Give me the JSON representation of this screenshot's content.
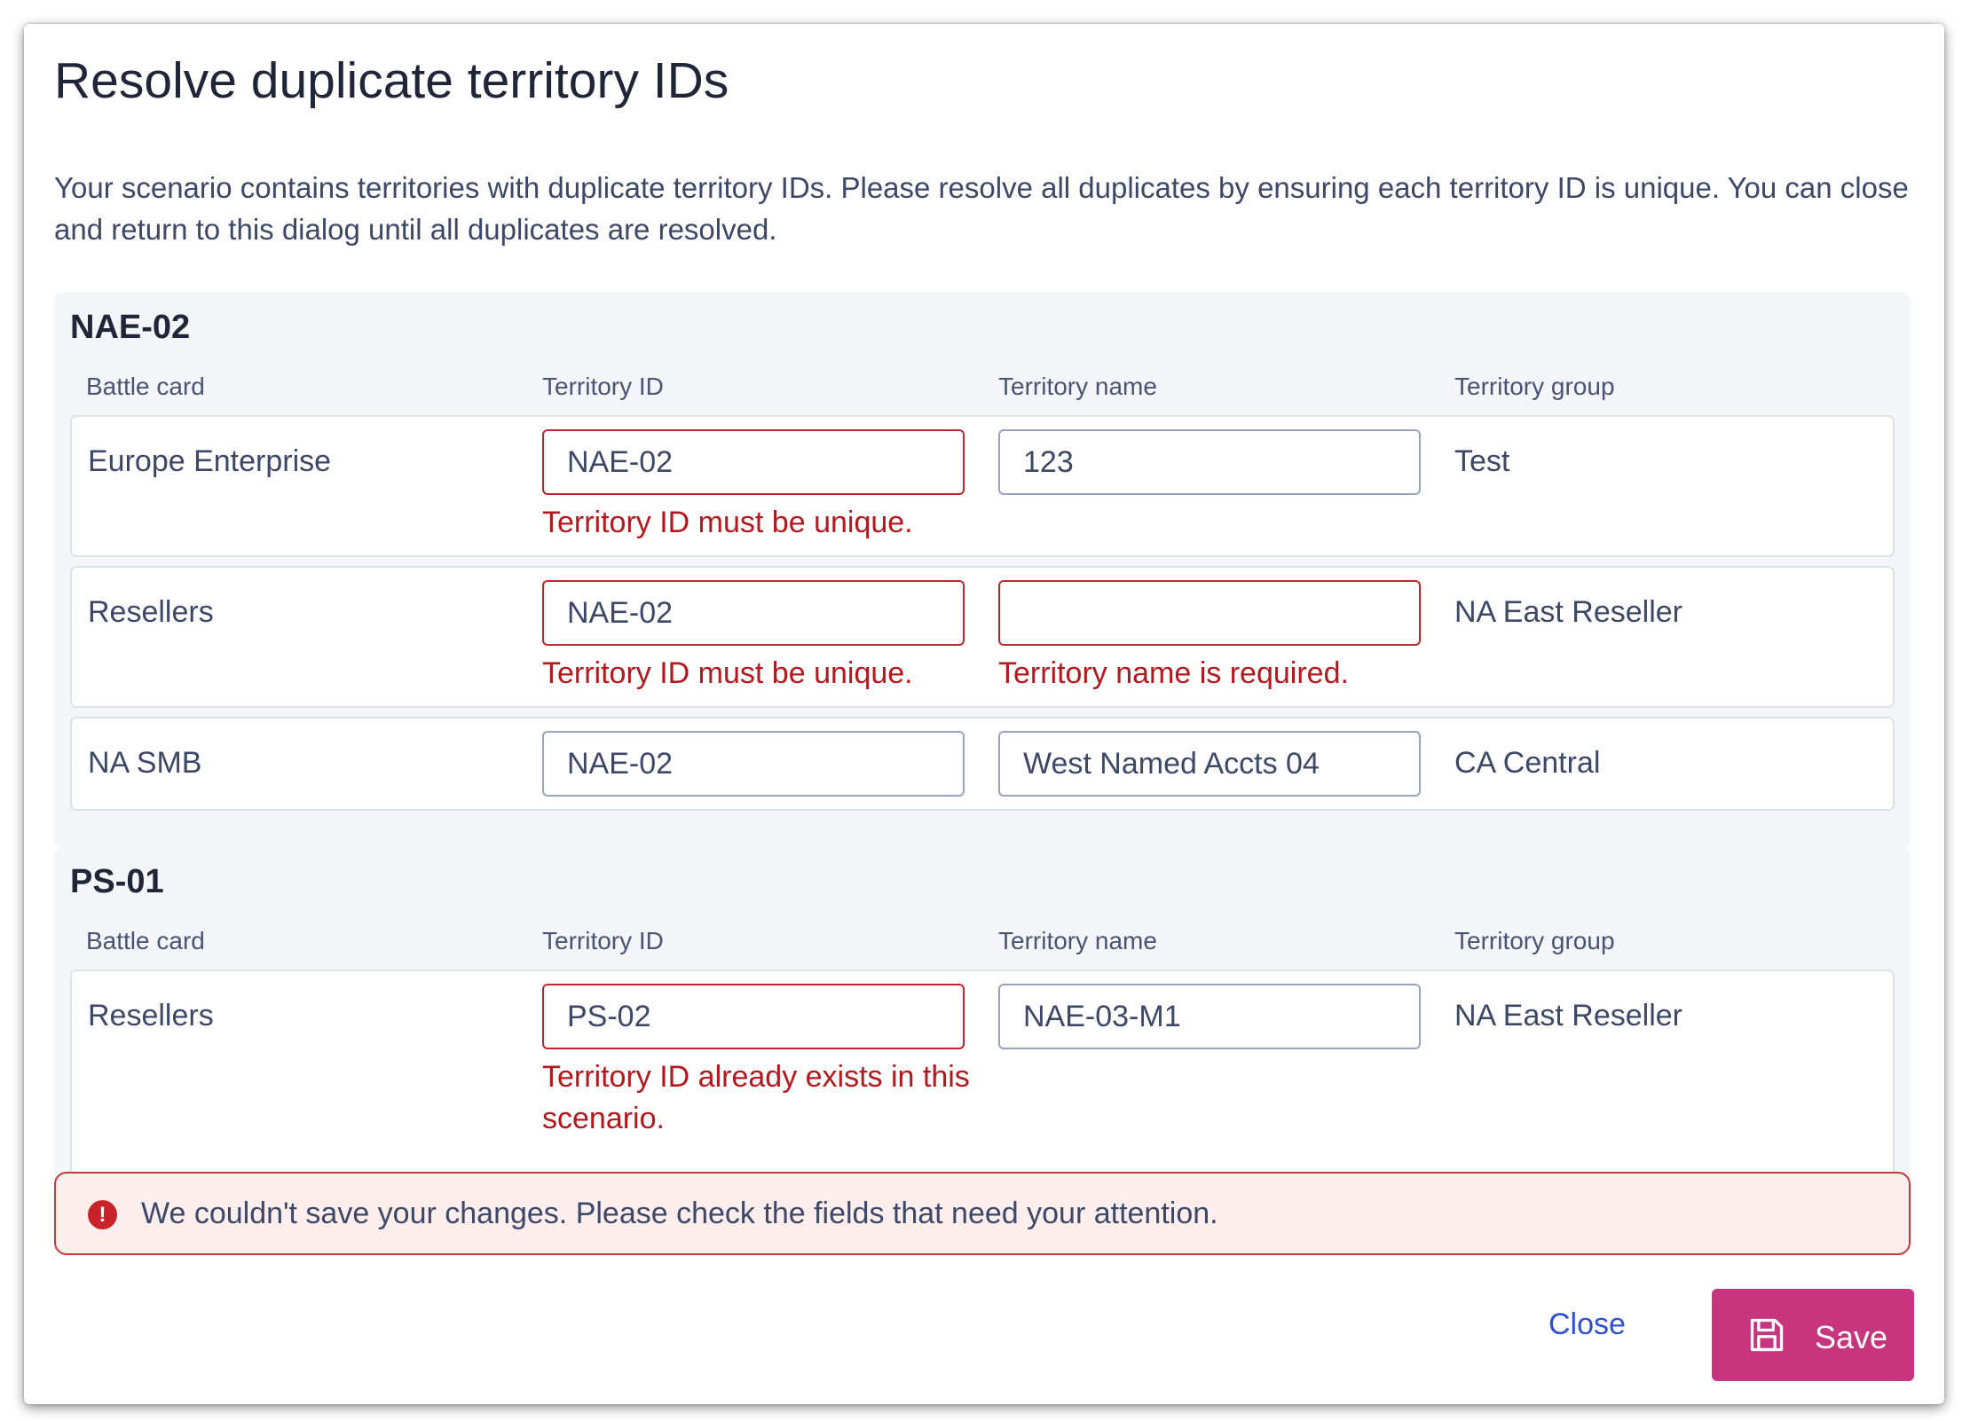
{
  "dialog": {
    "title": "Resolve duplicate territory IDs",
    "description": "Your scenario contains territories with duplicate territory IDs. Please resolve all duplicates by ensuring each territory ID is unique. You can close and return to this dialog until all duplicates are resolved."
  },
  "columns": [
    "Battle card",
    "Territory ID",
    "Territory name",
    "Territory group"
  ],
  "groups": [
    {
      "title": "NAE-02",
      "rows": [
        {
          "battle_card": "Europe Enterprise",
          "territory_id": "NAE-02",
          "territory_name": "123",
          "territory_group": "Test",
          "id_error": "Territory ID must be unique.",
          "name_error": ""
        },
        {
          "battle_card": "Resellers",
          "territory_id": "NAE-02",
          "territory_name": "",
          "territory_group": "NA East Reseller",
          "id_error": "Territory ID must be unique.",
          "name_error": "Territory name is required."
        },
        {
          "battle_card": "NA SMB",
          "territory_id": "NAE-02",
          "territory_name": "West Named Accts 04",
          "territory_group": "CA Central",
          "id_error": "",
          "name_error": ""
        }
      ]
    },
    {
      "title": "PS-01",
      "rows": [
        {
          "battle_card": "Resellers",
          "territory_id": "PS-02",
          "territory_name": "NAE-03-M1",
          "territory_group": "NA East Reseller",
          "id_error": "Territory ID already exists in this scenario.",
          "name_error": ""
        }
      ]
    }
  ],
  "alert": {
    "icon": "exclamation-circle-icon",
    "icon_glyph": "!",
    "message": "We couldn't save your changes. Please check the fields that need your attention."
  },
  "footer": {
    "close_label": "Close",
    "save_label": "Save",
    "save_icon": "floppy-disk-icon"
  },
  "colors": {
    "error": "#c2262d",
    "save_button": "#c8357f",
    "link": "#2f4fd6",
    "group_background": "#f4f5f9"
  }
}
